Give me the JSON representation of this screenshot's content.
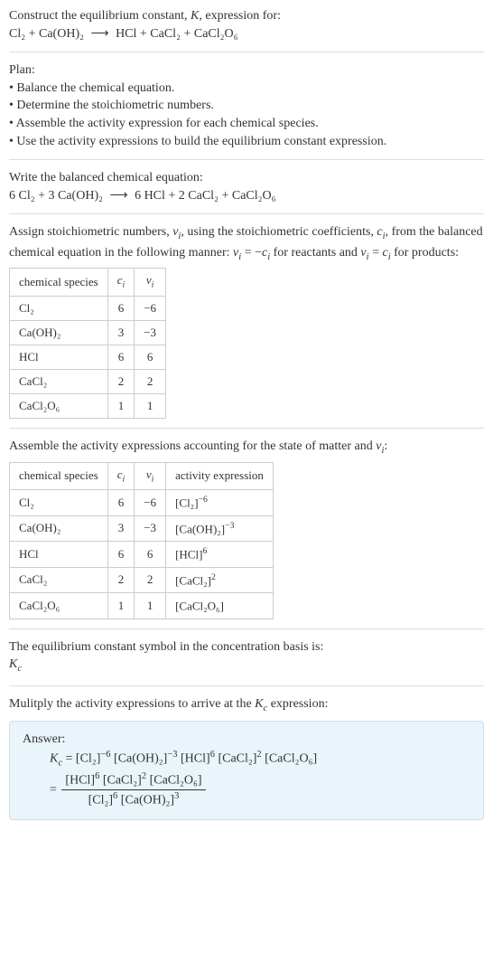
{
  "intro": {
    "line1": "Construct the equilibrium constant, ",
    "K": "K",
    "line1b": ", expression for:",
    "eq_lhs": "Cl₂ + Ca(OH)₂",
    "arrow": "⟶",
    "eq_rhs": "HCl + CaCl₂ + CaCl₂O₆"
  },
  "plan": {
    "title": "Plan:",
    "b1": "• Balance the chemical equation.",
    "b2": "• Determine the stoichiometric numbers.",
    "b3": "• Assemble the activity expression for each chemical species.",
    "b4": "• Use the activity expressions to build the equilibrium constant expression."
  },
  "balanced": {
    "title": "Write the balanced chemical equation:",
    "lhs": "6 Cl₂ + 3 Ca(OH)₂",
    "arrow": "⟶",
    "rhs": "6 HCl + 2 CaCl₂ + CaCl₂O₆"
  },
  "stoich": {
    "intro_a": "Assign stoichiometric numbers, ",
    "nu": "ν",
    "i": "i",
    "intro_b": ", using the stoichiometric coefficients, ",
    "c": "c",
    "intro_c": ", from the balanced chemical equation in the following manner: ",
    "rule_reac": " = −",
    "for_reac": " for reactants and ",
    "rule_prod": " = ",
    "for_prod": " for products:",
    "headers": {
      "sp": "chemical species",
      "ci": "cᵢ",
      "nui": "νᵢ"
    },
    "rows": [
      {
        "sp": "Cl₂",
        "c": "6",
        "nu": "−6"
      },
      {
        "sp": "Ca(OH)₂",
        "c": "3",
        "nu": "−3"
      },
      {
        "sp": "HCl",
        "c": "6",
        "nu": "6"
      },
      {
        "sp": "CaCl₂",
        "c": "2",
        "nu": "2"
      },
      {
        "sp": "CaCl₂O₆",
        "c": "1",
        "nu": "1"
      }
    ]
  },
  "activity": {
    "intro_a": "Assemble the activity expressions accounting for the state of matter and ",
    "intro_b": ":",
    "headers": {
      "sp": "chemical species",
      "ci": "cᵢ",
      "nui": "νᵢ",
      "ae": "activity expression"
    },
    "rows": [
      {
        "sp": "Cl₂",
        "c": "6",
        "nu": "−6",
        "ae_base": "[Cl₂]",
        "ae_exp": "−6"
      },
      {
        "sp": "Ca(OH)₂",
        "c": "3",
        "nu": "−3",
        "ae_base": "[Ca(OH)₂]",
        "ae_exp": "−3"
      },
      {
        "sp": "HCl",
        "c": "6",
        "nu": "6",
        "ae_base": "[HCl]",
        "ae_exp": "6"
      },
      {
        "sp": "CaCl₂",
        "c": "2",
        "nu": "2",
        "ae_base": "[CaCl₂]",
        "ae_exp": "2"
      },
      {
        "sp": "CaCl₂O₆",
        "c": "1",
        "nu": "1",
        "ae_base": "[CaCl₂O₆]",
        "ae_exp": ""
      }
    ]
  },
  "symbol": {
    "line": "The equilibrium constant symbol in the concentration basis is:",
    "K": "K",
    "c": "c"
  },
  "mult": {
    "line_a": "Mulitply the activity expressions to arrive at the ",
    "line_b": " expression:"
  },
  "answer": {
    "label": "Answer:",
    "Kc_K": "K",
    "Kc_c": "c",
    "eq": " = ",
    "t1": "[Cl₂]",
    "e1": "−6",
    "t2": "[Ca(OH)₂]",
    "e2": "−3",
    "t3": "[HCl]",
    "e3": "6",
    "t4": "[CaCl₂]",
    "e4": "2",
    "t5": "[CaCl₂O₆]",
    "eq2": " = ",
    "num_t1": "[HCl]",
    "num_e1": "6",
    "num_t2": "[CaCl₂]",
    "num_e2": "2",
    "num_t3": "[CaCl₂O₆]",
    "den_t1": "[Cl₂]",
    "den_e1": "6",
    "den_t2": "[Ca(OH)₂]",
    "den_e2": "3"
  }
}
